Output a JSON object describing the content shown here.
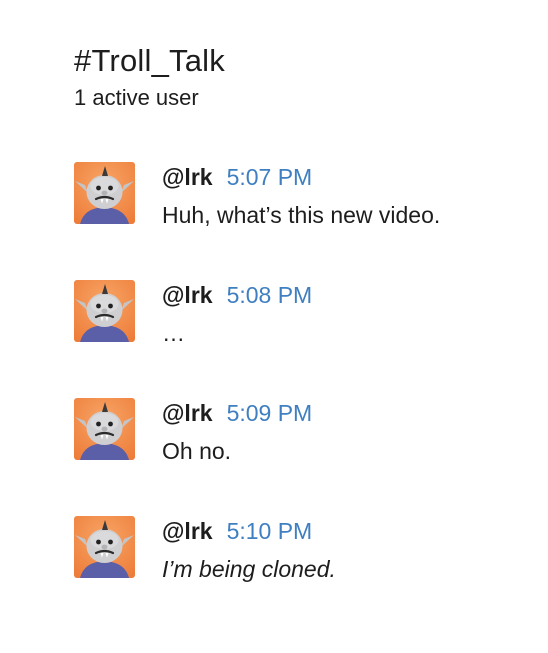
{
  "channel": {
    "title": "#Troll_Talk",
    "active_users": "1 active user"
  },
  "colors": {
    "timestamp": "#3f7fc1",
    "avatar_background": "#ee7d3a",
    "text": "#1d1d1d"
  },
  "messages": [
    {
      "avatar": "troll-avatar",
      "username": "@lrk",
      "time": "5:07 PM",
      "text": "Huh, what’s this new video.",
      "italic": false
    },
    {
      "avatar": "troll-avatar",
      "username": "@lrk",
      "time": "5:08 PM",
      "text": "…",
      "italic": false
    },
    {
      "avatar": "troll-avatar",
      "username": "@lrk",
      "time": "5:09 PM",
      "text": "Oh no.",
      "italic": false
    },
    {
      "avatar": "troll-avatar",
      "username": "@lrk",
      "time": "5:10 PM",
      "text": "I’m being cloned.",
      "italic": true
    }
  ]
}
